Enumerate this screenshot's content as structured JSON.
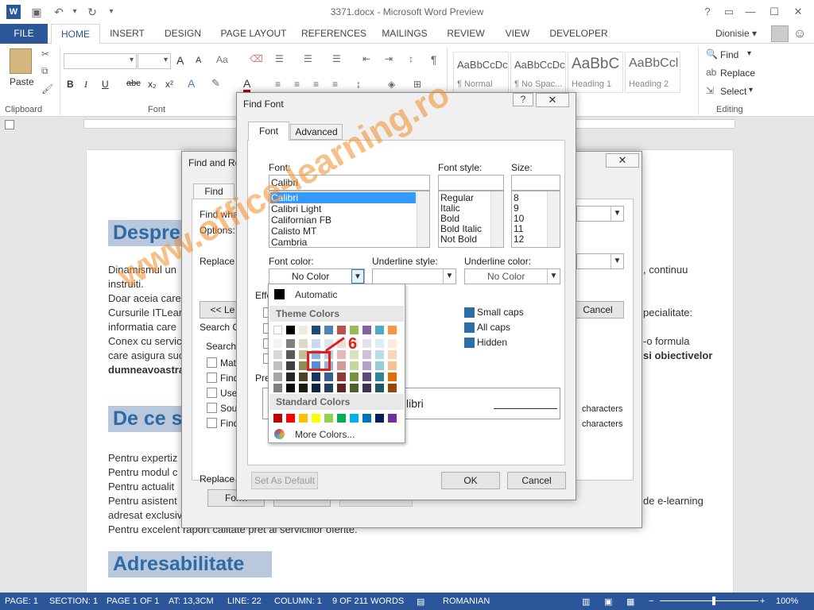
{
  "window": {
    "title": "3371.docx - Microsoft Word Preview",
    "help": "?"
  },
  "tabs": [
    "FILE",
    "HOME",
    "INSERT",
    "DESIGN",
    "PAGE LAYOUT",
    "REFERENCES",
    "MAILINGS",
    "REVIEW",
    "VIEW",
    "DEVELOPER"
  ],
  "user": {
    "name": "Dionisie"
  },
  "ribbon": {
    "paste": "Paste",
    "clipboard": "Clipboard",
    "font": "Font",
    "editing": "Editing",
    "find": "Find",
    "replace": "Replace",
    "select": "Select",
    "grow": "A",
    "shrink": "A",
    "case": "Aa",
    "bold": "B",
    "italic": "I",
    "underline": "U",
    "strike": "abc",
    "sub": "x₂",
    "sup": "x²",
    "styles": [
      {
        "preview": "AaBbCcDc",
        "name": "¶ Normal"
      },
      {
        "preview": "AaBbCcDc",
        "name": "¶ No Spac..."
      },
      {
        "preview": "AaBbC",
        "name": "Heading 1"
      },
      {
        "preview": "AaBbCcl",
        "name": "Heading 2"
      }
    ]
  },
  "document": {
    "headings": [
      "Despre",
      "De ce s",
      "Adresabilitate"
    ],
    "lines": [
      "Dinamismul un",
      "instruiti.",
      "Doar aceia care",
      "Cursurile ITLear",
      "informatia care",
      "Conex cu servic",
      "care asigura suc",
      "dumneavoastra"
    ],
    "right_lines": [
      ", continuu",
      "pecialitate:",
      "-o formula",
      "si obiectivelor"
    ],
    "lines2": [
      "Pentru expertiz",
      "Pentru modul c",
      "Pentru actualit",
      "Pentru asistent",
      "adresat exclusiv",
      "Pentru excelent raport calitate pret al serviciilor oferite."
    ],
    "right_lines2": [
      "de e-learning"
    ]
  },
  "find_replace": {
    "title": "Find and Re",
    "tab_find": "Find",
    "find_what": "Find wha",
    "options": "Options:",
    "replace_with": "Replace w",
    "less": "<< Le",
    "search_options": "Search O",
    "search": "Search:",
    "checks": [
      "Mat",
      "Find",
      "Use",
      "Sou",
      "Find"
    ],
    "characters": "characters",
    "replace": "Replace",
    "format": "Form",
    "cancel": "Cancel"
  },
  "find_font": {
    "title": "Find Font",
    "tabs": [
      "Font",
      "Advanced"
    ],
    "font_label": "Font:",
    "font_value": "Calibri",
    "fonts": [
      "Calibri",
      "Calibri Light",
      "Californian FB",
      "Calisto MT",
      "Cambria"
    ],
    "style_label": "Font style:",
    "styles": [
      "Regular",
      "Italic",
      "Bold",
      "Bold Italic",
      "Not Bold"
    ],
    "size_label": "Size:",
    "sizes": [
      "8",
      "9",
      "10",
      "11",
      "12"
    ],
    "font_color_label": "Font color:",
    "font_color_value": "No Color",
    "underline_style_label": "Underline style:",
    "underline_color_label": "Underline color:",
    "underline_color_value": "No Color",
    "effects": "Effe",
    "preview": "Pre",
    "preview_text": "libri",
    "right_effects": [
      "Small caps",
      "All caps",
      "Hidden"
    ],
    "set_default": "Set As Default",
    "ok": "OK",
    "cancel": "Cancel"
  },
  "palette": {
    "automatic": "Automatic",
    "theme_colors": "Theme Colors",
    "standard_colors": "Standard Colors",
    "more_colors": "More Colors...",
    "callout": "6",
    "theme_row": [
      "#ffffff",
      "#000000",
      "#eeece1",
      "#1f497d",
      "#4f81bd",
      "#c0504d",
      "#9bbb59",
      "#8064a2",
      "#4bacc6",
      "#f79646"
    ],
    "shade_rows": [
      [
        "#f2f2f2",
        "#7f7f7f",
        "#ddd9c3",
        "#c6d9f0",
        "#dbe5f1",
        "#f2dcdb",
        "#ebf1dd",
        "#e5e0ec",
        "#dbeef3",
        "#fdeada"
      ],
      [
        "#d8d8d8",
        "#595959",
        "#c4bd97",
        "#8db3e2",
        "#b8cce4",
        "#e5b9b7",
        "#d7e3bc",
        "#ccc1d9",
        "#b7dde8",
        "#fbd5b5"
      ],
      [
        "#bfbfbf",
        "#3f3f3f",
        "#938953",
        "#548dd4",
        "#95b3d7",
        "#d99694",
        "#c3d69b",
        "#b2a2c7",
        "#92cddc",
        "#fac08f"
      ],
      [
        "#a5a5a5",
        "#262626",
        "#494429",
        "#17365d",
        "#366092",
        "#953734",
        "#76923c",
        "#5f497a",
        "#31859b",
        "#e36c09"
      ],
      [
        "#7f7f7f",
        "#0c0c0c",
        "#1d1b10",
        "#0f243e",
        "#244061",
        "#632423",
        "#4f6128",
        "#3f3151",
        "#205867",
        "#974806"
      ]
    ],
    "standard": [
      "#c00000",
      "#ff0000",
      "#ffc000",
      "#ffff00",
      "#92d050",
      "#00b050",
      "#00b0f0",
      "#0070c0",
      "#002060",
      "#7030a0"
    ]
  },
  "status": {
    "page": "PAGE: 1",
    "section": "SECTION: 1",
    "pageof": "PAGE 1 OF 1",
    "at": "AT: 13,3CM",
    "line": "LINE: 22",
    "column": "COLUMN: 1",
    "words": "9 OF 211 WORDS",
    "lang": "ROMANIAN",
    "zoom": "100%"
  },
  "watermark": "www.office-learning.ro"
}
